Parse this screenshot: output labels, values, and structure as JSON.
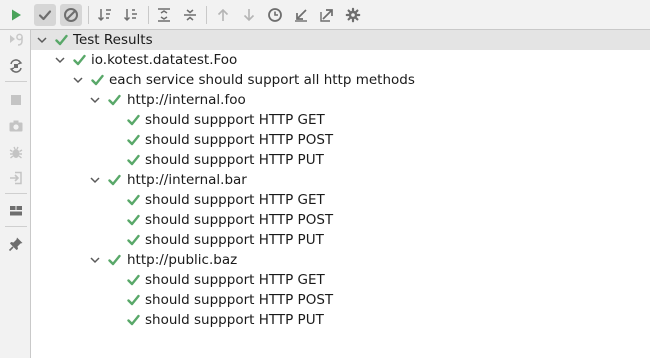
{
  "colors": {
    "pass": "#59a869",
    "icon": "#6e6e6e",
    "disabled": "#b5b5b5",
    "run": "#4aa35a"
  },
  "toolbar": {
    "buttons": [
      {
        "name": "show-passed-toggle",
        "icon": "check-icon",
        "pressed": true
      },
      {
        "name": "show-ignored-toggle",
        "icon": "ban-icon",
        "pressed": true
      },
      {
        "name": "sort-alphabetically-button",
        "icon": "sort-alpha-icon"
      },
      {
        "name": "sort-by-duration-button",
        "icon": "sort-duration-icon"
      },
      {
        "name": "expand-all-button",
        "icon": "expand-all-icon"
      },
      {
        "name": "collapse-all-button",
        "icon": "collapse-all-icon"
      },
      {
        "name": "previous-failed-button",
        "icon": "arrow-up-icon",
        "disabled": true
      },
      {
        "name": "next-failed-button",
        "icon": "arrow-down-icon",
        "disabled": true
      },
      {
        "name": "test-history-button",
        "icon": "clock-icon"
      },
      {
        "name": "import-tests-button",
        "icon": "import-arrow-icon"
      },
      {
        "name": "export-tests-button",
        "icon": "export-arrow-icon"
      },
      {
        "name": "settings-button",
        "icon": "gear-icon"
      }
    ]
  },
  "sidebar": {
    "buttons": [
      {
        "name": "rerun-button",
        "icon": "play-icon"
      },
      {
        "name": "rerun-failed-button",
        "icon": "rerun-failed-icon",
        "disabled": true
      },
      {
        "name": "toggle-auto-test-button",
        "icon": "auto-rerun-icon"
      },
      {
        "name": "stop-button",
        "icon": "stop-icon",
        "disabled": true
      },
      {
        "name": "screenshot-button",
        "icon": "camera-icon",
        "disabled": true
      },
      {
        "name": "debug-button",
        "icon": "bug-icon",
        "disabled": true
      },
      {
        "name": "exit-button",
        "icon": "exit-icon",
        "disabled": true
      },
      {
        "name": "layout-button",
        "icon": "layout-icon"
      },
      {
        "name": "pin-tab-button",
        "icon": "pin-icon"
      }
    ]
  },
  "tree": {
    "root": {
      "label": "Test Results",
      "status": "passed"
    },
    "spec": {
      "label": "io.kotest.datatest.Foo",
      "status": "passed"
    },
    "context": {
      "label": "each service should support all http methods",
      "status": "passed"
    },
    "groups": [
      {
        "label": "http://internal.foo",
        "status": "passed",
        "tests": [
          {
            "label": "should suppport HTTP GET",
            "status": "passed"
          },
          {
            "label": "should suppport HTTP POST",
            "status": "passed"
          },
          {
            "label": "should suppport HTTP PUT",
            "status": "passed"
          }
        ]
      },
      {
        "label": "http://internal.bar",
        "status": "passed",
        "tests": [
          {
            "label": "should suppport HTTP GET",
            "status": "passed"
          },
          {
            "label": "should suppport HTTP POST",
            "status": "passed"
          },
          {
            "label": "should suppport HTTP PUT",
            "status": "passed"
          }
        ]
      },
      {
        "label": "http://public.baz",
        "status": "passed",
        "tests": [
          {
            "label": "should suppport HTTP GET",
            "status": "passed"
          },
          {
            "label": "should suppport HTTP POST",
            "status": "passed"
          },
          {
            "label": "should suppport HTTP PUT",
            "status": "passed"
          }
        ]
      }
    ]
  }
}
